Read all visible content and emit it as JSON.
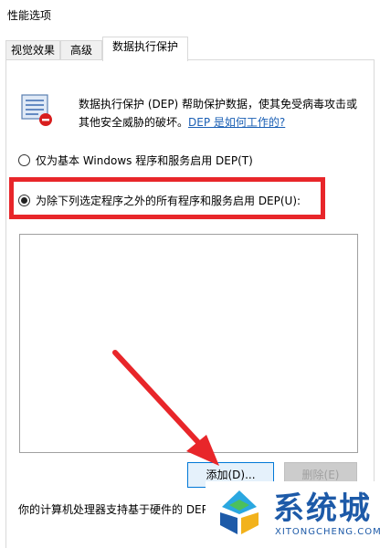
{
  "window": {
    "title": "性能选项"
  },
  "tabs": [
    {
      "label": "视觉效果"
    },
    {
      "label": "高级"
    },
    {
      "label": "数据执行保护"
    }
  ],
  "dep": {
    "desc_line1": "数据执行保护 (DEP) 帮助保护数据，使其免受病毒攻击或",
    "desc_line2_prefix": "其他安全威胁的破坏。",
    "desc_link": "DEP 是如何工作的?",
    "icon": "dep-shield-icon"
  },
  "options": {
    "basic_label": "仅为基本 Windows 程序和服务启用 DEP(T)",
    "all_label": "为除下列选定程序之外的所有程序和服务启用 DEP(U):",
    "selected": "all"
  },
  "buttons": {
    "add_label": "添加(D)...",
    "delete_label": "删除(E)"
  },
  "status": {
    "text": "你的计算机处理器支持基于硬件的 DEP"
  },
  "watermark": {
    "name": "系统城",
    "url": "XITONGCHENG.COM"
  },
  "colors": {
    "highlight": "#e8262a",
    "link": "#1a5fb4",
    "watermark": "#1d5aa8"
  }
}
